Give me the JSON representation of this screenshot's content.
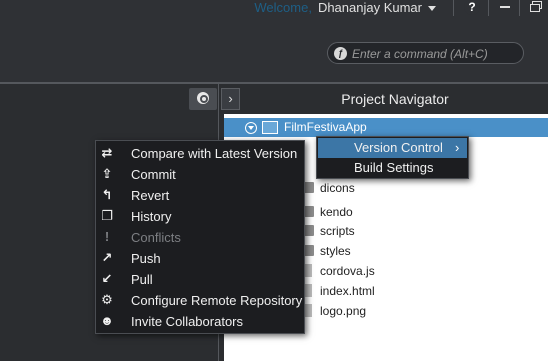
{
  "header": {
    "welcome_label": "Welcome,",
    "username": "Dhananjay Kumar",
    "help_label": "?",
    "command": {
      "placeholder": "Enter a command (Alt+C)"
    }
  },
  "navigator": {
    "title": "Project Navigator",
    "expand_glyph": "›",
    "root": "FilmFestivaApp",
    "items": [
      {
        "label": "dicons",
        "kind": "folder"
      },
      {
        "label": "kendo",
        "kind": "folder"
      },
      {
        "label": "scripts",
        "kind": "folder"
      },
      {
        "label": "styles",
        "kind": "folder"
      },
      {
        "label": "cordova.js",
        "kind": "file"
      },
      {
        "label": "index.html",
        "kind": "file"
      },
      {
        "label": "logo.png",
        "kind": "file"
      }
    ]
  },
  "context_menu": {
    "items": [
      {
        "label": "Compare with Latest Version",
        "icon": "compare-arrows-icon",
        "glyph": "⇄",
        "enabled": true
      },
      {
        "label": "Commit",
        "icon": "commit-icon",
        "glyph": "⇪",
        "enabled": true
      },
      {
        "label": "Revert",
        "icon": "revert-icon",
        "glyph": "↰",
        "enabled": true
      },
      {
        "label": "History",
        "icon": "history-icon",
        "glyph": "❐",
        "enabled": true
      },
      {
        "label": "Conflicts",
        "icon": "conflict-icon",
        "glyph": "!",
        "enabled": false
      },
      {
        "label": "Push",
        "icon": "push-icon",
        "glyph": "↗",
        "enabled": true
      },
      {
        "label": "Pull",
        "icon": "pull-icon",
        "glyph": "↙",
        "enabled": true
      },
      {
        "label": "Configure Remote Repository",
        "icon": "remote-repo-icon",
        "glyph": "⚙",
        "enabled": true
      },
      {
        "label": "Invite Collaborators",
        "icon": "collaborators-icon",
        "glyph": "☻",
        "enabled": true
      }
    ]
  },
  "submenu": {
    "items": [
      {
        "label": "Version Control",
        "active": true,
        "chevron": "›"
      },
      {
        "label": "Build Settings",
        "active": false,
        "chevron": ""
      }
    ]
  },
  "colors": {
    "accent": "#4a90c8",
    "menu_bg": "#1c1d20",
    "welcome": "#1e5f86"
  }
}
